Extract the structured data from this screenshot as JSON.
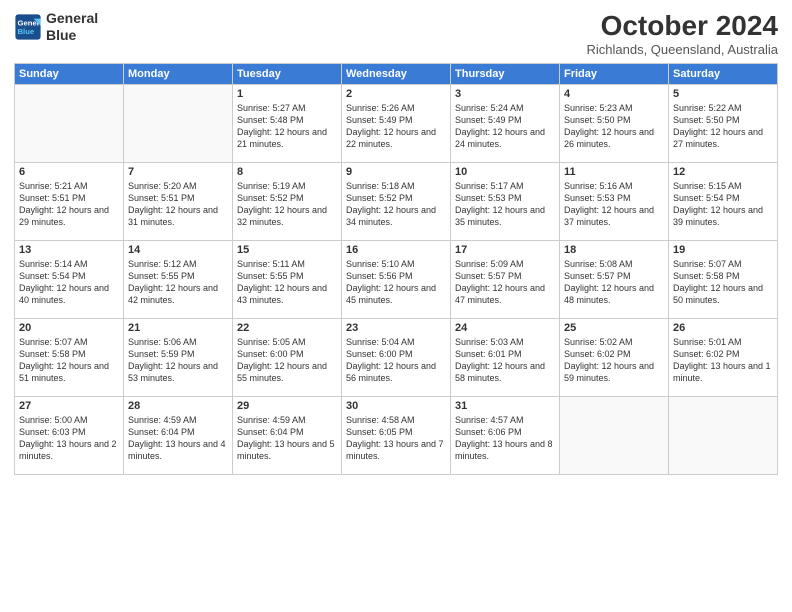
{
  "header": {
    "logo_line1": "General",
    "logo_line2": "Blue",
    "month": "October 2024",
    "location": "Richlands, Queensland, Australia"
  },
  "weekdays": [
    "Sunday",
    "Monday",
    "Tuesday",
    "Wednesday",
    "Thursday",
    "Friday",
    "Saturday"
  ],
  "weeks": [
    [
      {
        "day": "",
        "text": ""
      },
      {
        "day": "",
        "text": ""
      },
      {
        "day": "1",
        "text": "Sunrise: 5:27 AM\nSunset: 5:48 PM\nDaylight: 12 hours and 21 minutes."
      },
      {
        "day": "2",
        "text": "Sunrise: 5:26 AM\nSunset: 5:49 PM\nDaylight: 12 hours and 22 minutes."
      },
      {
        "day": "3",
        "text": "Sunrise: 5:24 AM\nSunset: 5:49 PM\nDaylight: 12 hours and 24 minutes."
      },
      {
        "day": "4",
        "text": "Sunrise: 5:23 AM\nSunset: 5:50 PM\nDaylight: 12 hours and 26 minutes."
      },
      {
        "day": "5",
        "text": "Sunrise: 5:22 AM\nSunset: 5:50 PM\nDaylight: 12 hours and 27 minutes."
      }
    ],
    [
      {
        "day": "6",
        "text": "Sunrise: 5:21 AM\nSunset: 5:51 PM\nDaylight: 12 hours and 29 minutes."
      },
      {
        "day": "7",
        "text": "Sunrise: 5:20 AM\nSunset: 5:51 PM\nDaylight: 12 hours and 31 minutes."
      },
      {
        "day": "8",
        "text": "Sunrise: 5:19 AM\nSunset: 5:52 PM\nDaylight: 12 hours and 32 minutes."
      },
      {
        "day": "9",
        "text": "Sunrise: 5:18 AM\nSunset: 5:52 PM\nDaylight: 12 hours and 34 minutes."
      },
      {
        "day": "10",
        "text": "Sunrise: 5:17 AM\nSunset: 5:53 PM\nDaylight: 12 hours and 35 minutes."
      },
      {
        "day": "11",
        "text": "Sunrise: 5:16 AM\nSunset: 5:53 PM\nDaylight: 12 hours and 37 minutes."
      },
      {
        "day": "12",
        "text": "Sunrise: 5:15 AM\nSunset: 5:54 PM\nDaylight: 12 hours and 39 minutes."
      }
    ],
    [
      {
        "day": "13",
        "text": "Sunrise: 5:14 AM\nSunset: 5:54 PM\nDaylight: 12 hours and 40 minutes."
      },
      {
        "day": "14",
        "text": "Sunrise: 5:12 AM\nSunset: 5:55 PM\nDaylight: 12 hours and 42 minutes."
      },
      {
        "day": "15",
        "text": "Sunrise: 5:11 AM\nSunset: 5:55 PM\nDaylight: 12 hours and 43 minutes."
      },
      {
        "day": "16",
        "text": "Sunrise: 5:10 AM\nSunset: 5:56 PM\nDaylight: 12 hours and 45 minutes."
      },
      {
        "day": "17",
        "text": "Sunrise: 5:09 AM\nSunset: 5:57 PM\nDaylight: 12 hours and 47 minutes."
      },
      {
        "day": "18",
        "text": "Sunrise: 5:08 AM\nSunset: 5:57 PM\nDaylight: 12 hours and 48 minutes."
      },
      {
        "day": "19",
        "text": "Sunrise: 5:07 AM\nSunset: 5:58 PM\nDaylight: 12 hours and 50 minutes."
      }
    ],
    [
      {
        "day": "20",
        "text": "Sunrise: 5:07 AM\nSunset: 5:58 PM\nDaylight: 12 hours and 51 minutes."
      },
      {
        "day": "21",
        "text": "Sunrise: 5:06 AM\nSunset: 5:59 PM\nDaylight: 12 hours and 53 minutes."
      },
      {
        "day": "22",
        "text": "Sunrise: 5:05 AM\nSunset: 6:00 PM\nDaylight: 12 hours and 55 minutes."
      },
      {
        "day": "23",
        "text": "Sunrise: 5:04 AM\nSunset: 6:00 PM\nDaylight: 12 hours and 56 minutes."
      },
      {
        "day": "24",
        "text": "Sunrise: 5:03 AM\nSunset: 6:01 PM\nDaylight: 12 hours and 58 minutes."
      },
      {
        "day": "25",
        "text": "Sunrise: 5:02 AM\nSunset: 6:02 PM\nDaylight: 12 hours and 59 minutes."
      },
      {
        "day": "26",
        "text": "Sunrise: 5:01 AM\nSunset: 6:02 PM\nDaylight: 13 hours and 1 minute."
      }
    ],
    [
      {
        "day": "27",
        "text": "Sunrise: 5:00 AM\nSunset: 6:03 PM\nDaylight: 13 hours and 2 minutes."
      },
      {
        "day": "28",
        "text": "Sunrise: 4:59 AM\nSunset: 6:04 PM\nDaylight: 13 hours and 4 minutes."
      },
      {
        "day": "29",
        "text": "Sunrise: 4:59 AM\nSunset: 6:04 PM\nDaylight: 13 hours and 5 minutes."
      },
      {
        "day": "30",
        "text": "Sunrise: 4:58 AM\nSunset: 6:05 PM\nDaylight: 13 hours and 7 minutes."
      },
      {
        "day": "31",
        "text": "Sunrise: 4:57 AM\nSunset: 6:06 PM\nDaylight: 13 hours and 8 minutes."
      },
      {
        "day": "",
        "text": ""
      },
      {
        "day": "",
        "text": ""
      }
    ]
  ]
}
